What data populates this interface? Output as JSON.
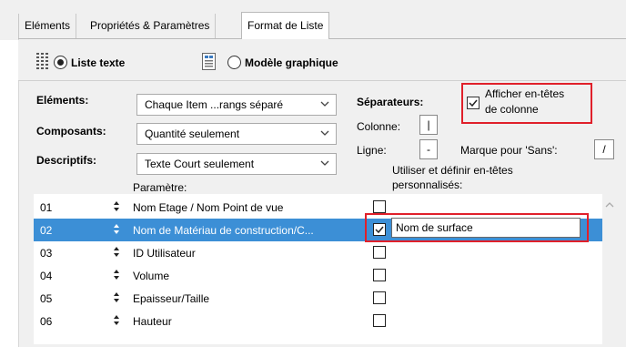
{
  "tabs": [
    {
      "label": "Eléments"
    },
    {
      "label": "Propriétés & Paramètres"
    },
    {
      "label": "Format de Liste",
      "active": true
    }
  ],
  "modes": {
    "list_text": {
      "label": "Liste texte",
      "selected": true
    },
    "graphic_model": {
      "label": "Modèle graphique",
      "selected": false
    }
  },
  "fields": {
    "elements": {
      "label": "Eléments:",
      "value": "Chaque Item ...rangs séparé"
    },
    "components": {
      "label": "Composants:",
      "value": "Quantité seulement"
    },
    "descriptives": {
      "label": "Descriptifs:",
      "value": "Texte Court seulement"
    }
  },
  "separators": {
    "label": "Séparateurs:",
    "column_label": "Colonne:",
    "column_value": "|",
    "row_label": "Ligne:",
    "row_value": "-",
    "none_mark_label": "Marque pour 'Sans':",
    "none_mark_value": "/"
  },
  "show_headers": {
    "label_line1": "Afficher en-têtes",
    "label_line2": "de colonne",
    "checked": true
  },
  "custom_headers_label_line1": "Utiliser et définir en-têtes",
  "custom_headers_label_line2": "personnalisés:",
  "parametre_header": "Paramètre:",
  "rows": [
    {
      "num": "01",
      "name": "Nom Etage / Nom Point de vue",
      "checked": false,
      "selected": false
    },
    {
      "num": "02",
      "name": "Nom de Matériau de construction/C...",
      "checked": true,
      "selected": true,
      "header": "Nom de surface"
    },
    {
      "num": "03",
      "name": "ID Utilisateur",
      "checked": false,
      "selected": false
    },
    {
      "num": "04",
      "name": "Volume",
      "checked": false,
      "selected": false
    },
    {
      "num": "05",
      "name": "Epaisseur/Taille",
      "checked": false,
      "selected": false
    },
    {
      "num": "06",
      "name": "Hauteur",
      "checked": false,
      "selected": false
    }
  ],
  "colors": {
    "selection": "#3c8fd6",
    "highlight_box": "#e0202a",
    "panel": "#f0f0f0"
  },
  "icons": [
    "list-text-icon",
    "graphic-model-icon",
    "chevron-down-icon",
    "checkmark-icon",
    "sort-arrows-icon",
    "scroll-up-icon"
  ]
}
